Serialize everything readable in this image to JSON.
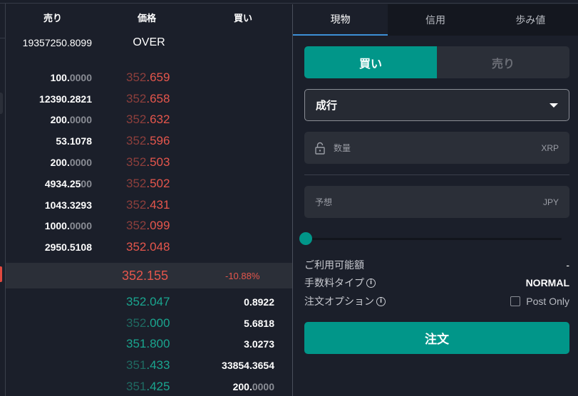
{
  "orderbook": {
    "headers": {
      "sell": "売り",
      "price": "価格",
      "buy": "買い"
    },
    "over_row": {
      "qty": "19357250.8099",
      "label": "OVER"
    },
    "asks": [
      {
        "qty_main": "100.",
        "qty_dim": "0000",
        "price_int": "352",
        "price_dec": ".659",
        "bright": false
      },
      {
        "qty_main": "12390.2821",
        "qty_dim": "",
        "price_int": "352",
        "price_dec": ".658",
        "bright": false
      },
      {
        "qty_main": "200.",
        "qty_dim": "0000",
        "price_int": "352",
        "price_dec": ".632",
        "bright": false
      },
      {
        "qty_main": "53.1078",
        "qty_dim": "",
        "price_int": "352",
        "price_dec": ".596",
        "bright": false
      },
      {
        "qty_main": "200.",
        "qty_dim": "0000",
        "price_int": "352",
        "price_dec": ".503",
        "bright": false
      },
      {
        "qty_main": "4934.25",
        "qty_dim": "00",
        "price_int": "352",
        "price_dec": ".502",
        "bright": false
      },
      {
        "qty_main": "1043.3293",
        "qty_dim": "",
        "price_int": "352",
        "price_dec": ".431",
        "bright": false
      },
      {
        "qty_main": "1000.",
        "qty_dim": "0000",
        "price_int": "352",
        "price_dec": ".099",
        "bright": false
      },
      {
        "qty_main": "2950.5108",
        "qty_dim": "",
        "price_int": "352",
        "price_dec": ".048",
        "bright": true
      }
    ],
    "last_price": "352.155",
    "change": "-10.88%",
    "bids": [
      {
        "price_int": "352",
        "price_dec": ".047",
        "bright": true,
        "qty_main": "0.8922",
        "qty_dim": ""
      },
      {
        "price_int": "352",
        "price_dec": ".000",
        "bright": false,
        "qty_main": "5.6818",
        "qty_dim": ""
      },
      {
        "price_int": "351",
        "price_dec": ".800",
        "bright": true,
        "qty_main": "3.0273",
        "qty_dim": ""
      },
      {
        "price_int": "351",
        "price_dec": ".433",
        "bright": false,
        "qty_main": "33854.3654",
        "qty_dim": ""
      },
      {
        "price_int": "351",
        "price_dec": ".425",
        "bright": false,
        "qty_main": "200.",
        "qty_dim": "0000"
      }
    ]
  },
  "panel": {
    "tabs": [
      {
        "label": "現物",
        "active": true
      },
      {
        "label": "信用",
        "active": false
      },
      {
        "label": "歩み値",
        "active": false
      }
    ],
    "side": {
      "buy": "買い",
      "sell": "売り",
      "selected": "buy"
    },
    "order_type": {
      "value": "成行",
      "icon": "caret-down-icon"
    },
    "quantity": {
      "placeholder": "数量",
      "unit": "XRP",
      "icon": "unlock-icon"
    },
    "estimate": {
      "placeholder": "予想",
      "unit": "JPY"
    },
    "slider": {
      "percent": 0
    },
    "info": {
      "available_label": "ご利用可能額",
      "available_value": "-",
      "fee_label": "手数料タイプ",
      "fee_value": "NORMAL",
      "option_label": "注文オプション",
      "post_only_label": "Post Only",
      "post_only_checked": false
    },
    "submit_label": "注文"
  },
  "colors": {
    "buy_accent": "#019689",
    "ask_red": "#e5564c",
    "bid_green": "#1aa58f",
    "tab_underline": "#3d8fd6"
  }
}
